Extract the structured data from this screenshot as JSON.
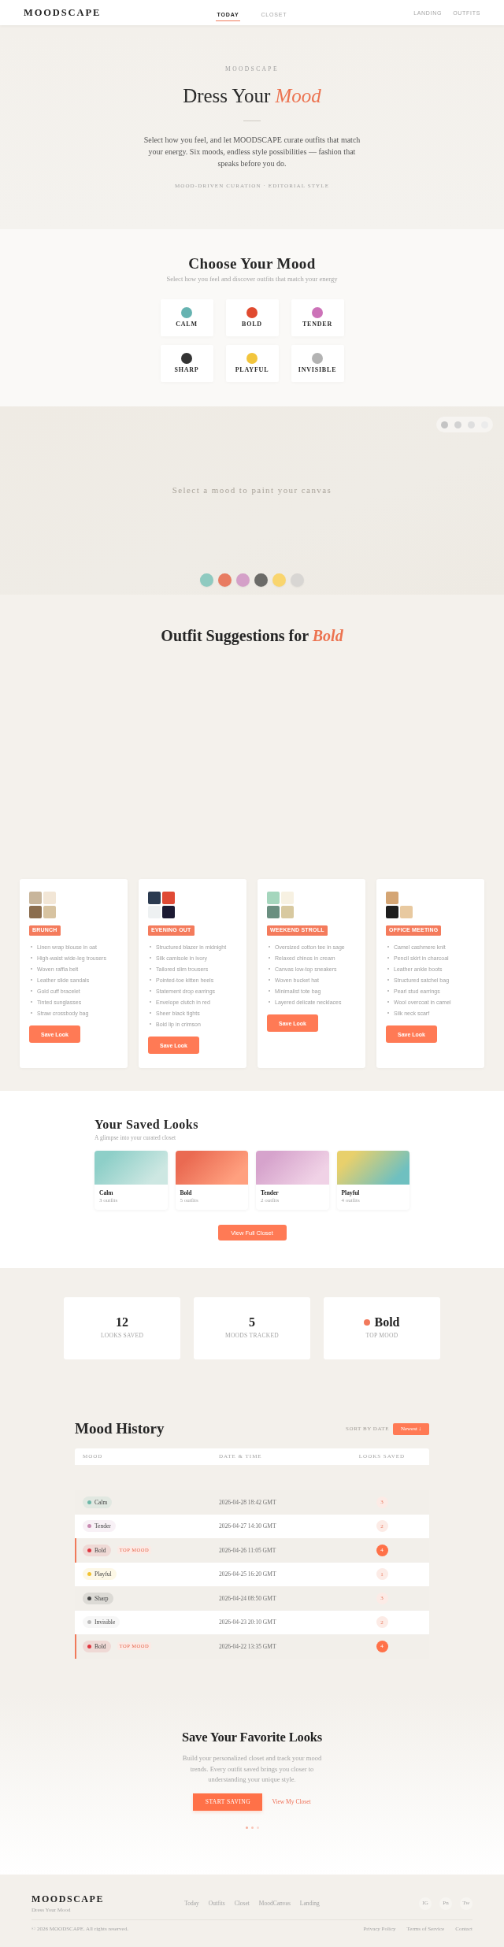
{
  "nav": {
    "logo": "MOODSCAPE",
    "tabs": [
      {
        "label": "TODAY",
        "selected": true
      },
      {
        "label": "CLOSET",
        "selected": false
      }
    ],
    "links": [
      {
        "label": "LANDING"
      },
      {
        "label": "OUTFITS"
      }
    ]
  },
  "hero": {
    "eyebrow": "MOODSCAPE",
    "title": "Dress Your *Mood*",
    "text": "Select how you feel, and let MOODSCAPE curate outfits that match your energy. Six moods, endless style possibilities — fashion that speaks before you do.",
    "tagline": "MOOD-DRIVEN CURATION · EDITORIAL STYLE"
  },
  "moods": {
    "title": "Choose Your Mood",
    "subtitle": "Select how you feel and discover outfits that match your energy",
    "items": [
      {
        "label": "CALM",
        "color": "#66b3b1"
      },
      {
        "label": "BOLD",
        "color": "#e04a2f"
      },
      {
        "label": "TENDER",
        "color": "#cc72b8"
      },
      {
        "label": "SHARP",
        "color": "#333333"
      },
      {
        "label": "PLAYFUL",
        "color": "#f2c53d"
      },
      {
        "label": "INVISIBLE",
        "color": "#b3b3b3"
      }
    ]
  },
  "canvas": {
    "message": "Select a mood to paint your canvas",
    "tools": [
      {
        "color": "#c4c4c4"
      },
      {
        "color": "#d2d2d2"
      },
      {
        "color": "#dedede"
      },
      {
        "color": "#ebebeb"
      }
    ],
    "palette": [
      {
        "color": "#8fcac0"
      },
      {
        "color": "#e87c62"
      },
      {
        "color": "#d4a0c8"
      },
      {
        "color": "#6b6b68"
      },
      {
        "color": "#f9d56e"
      },
      {
        "color": "#d8d6d3"
      }
    ]
  },
  "outfits": {
    "title": "Outfit Suggestions for *Bold*",
    "cards": [
      {
        "occasion": "BRUNCH",
        "swatch_rows": [
          [
            {
              "color": "#c8b59b"
            },
            {
              "color": "#f2e6d6"
            }
          ],
          [
            {
              "color": "#8b6d4e"
            },
            {
              "color": "#d7c3a1"
            }
          ]
        ],
        "items": [
          "Linen wrap blouse in oat",
          "High-waist wide-leg trousers",
          "Woven raffia belt",
          "Leather slide sandals",
          "Gold cuff bracelet",
          "Tinted sunglasses",
          "Straw crossbody bag"
        ],
        "button": "Save Look"
      },
      {
        "occasion": "EVENING OUT",
        "swatch_rows": [
          [
            {
              "color": "#2b3a50"
            },
            {
              "color": "#e04a35"
            }
          ],
          [
            {
              "color": "#eef1f2"
            },
            {
              "color": "#1c1a33"
            }
          ]
        ],
        "items": [
          "Structured blazer in midnight",
          "Silk camisole in ivory",
          "Tailored slim trousers",
          "Pointed-toe kitten heels",
          "Statement drop earrings",
          "Envelope clutch in red",
          "Sheer black tights",
          "Bold lip in crimson"
        ],
        "button": "Save Look"
      },
      {
        "occasion": "WEEKEND STROLL",
        "swatch_rows": [
          [
            {
              "color": "#a5d6bd"
            },
            {
              "color": "#f7f1e2"
            }
          ],
          [
            {
              "color": "#6a8f80"
            },
            {
              "color": "#d8c9a0"
            }
          ]
        ],
        "items": [
          "Oversized cotton tee in sage",
          "Relaxed chinos in cream",
          "Canvas low-top sneakers",
          "Woven bucket hat",
          "Minimalist tote bag",
          "Layered delicate necklaces"
        ],
        "button": "Save Look"
      },
      {
        "occasion": "OFFICE MEETING",
        "swatch_rows": [
          [
            {
              "color": "#d4a574"
            }
          ],
          [
            {
              "color": "#1e1e1e"
            },
            {
              "color": "#e8c9a0"
            }
          ]
        ],
        "items": [
          "Camel cashmere knit",
          "Pencil skirt in charcoal",
          "Leather ankle boots",
          "Structured satchel bag",
          "Pearl stud earrings",
          "Wool overcoat in camel",
          "Silk neck scarf"
        ],
        "button": "Save Look"
      }
    ]
  },
  "saved_looks": {
    "title": "Your Saved Looks",
    "subtitle": "A glimpse into your curated closet",
    "items": [
      {
        "name": "Calm",
        "count": "3 outfits",
        "gradient": [
          {
            "color": "#8ecfc8"
          },
          {
            "color": "#cde7e2"
          }
        ]
      },
      {
        "name": "Bold",
        "count": "5 outfits",
        "gradient": [
          {
            "color": "#ea6a52"
          },
          {
            "color": "#ffa07f"
          }
        ]
      },
      {
        "name": "Tender",
        "count": "2 outfits",
        "gradient": [
          {
            "color": "#d6a3cc"
          },
          {
            "color": "#f0d2e6"
          }
        ]
      },
      {
        "name": "Playful",
        "count": "4 outfits",
        "gradient": [
          {
            "color": "#e8d06c"
          },
          {
            "color": "#6fc0c0"
          }
        ]
      }
    ],
    "button": "View Full Closet"
  },
  "stats": [
    {
      "value": "12",
      "label": "LOOKS SAVED"
    },
    {
      "value": "5",
      "label": "MOODS TRACKED"
    },
    {
      "value": "Bold",
      "label": "TOP MOOD",
      "color": "#f27a5c"
    }
  ],
  "history": {
    "title": "Mood History",
    "sort_label": "SORT BY DATE",
    "sort_button": "Newest ↓",
    "columns": [
      "MOOD",
      "DATE & TIME",
      "LOOKS SAVED"
    ],
    "rows": [
      {
        "mood": "Calm",
        "color": "#6cb7a8",
        "date": "2026-04-28 18:42 GMT",
        "looks": "3",
        "highlighted": false
      },
      {
        "mood": "Tender",
        "color": "#c98bb2",
        "date": "2026-04-27 14:30 GMT",
        "looks": "2",
        "highlighted": false
      },
      {
        "mood": "Bold",
        "color": "#e0363f",
        "tag": "TOP MOOD",
        "date": "2026-04-26 11:05 GMT",
        "looks": "4",
        "highlighted": true
      },
      {
        "mood": "Playful",
        "color": "#f2c230",
        "date": "2026-04-25 16:20 GMT",
        "looks": "1",
        "highlighted": false
      },
      {
        "mood": "Sharp",
        "color": "#444444",
        "date": "2026-04-24 08:50 GMT",
        "looks": "3",
        "highlighted": false
      },
      {
        "mood": "Invisible",
        "color": "#bbbbbb",
        "date": "2026-04-23 20:10 GMT",
        "looks": "2",
        "highlighted": false
      },
      {
        "mood": "Bold",
        "color": "#e0363f",
        "tag": "TOP MOOD",
        "date": "2026-04-22 13:35 GMT",
        "looks": "4",
        "highlighted": true
      }
    ]
  },
  "cta": {
    "title": "Save Your Favorite Looks",
    "text": "Build your personalized closet and track your mood trends. Every outfit saved brings you closer to understanding your unique style.",
    "button": "START SAVING",
    "link": "View My Closet"
  },
  "footer": {
    "logo": "MOODSCAPE",
    "tagline": "Dress Your Mood",
    "links": [
      "Today",
      "Outfits",
      "Closet",
      "MoodCanvas",
      "Landing"
    ],
    "social": [
      "IG",
      "Pn",
      "Tw"
    ],
    "copyright": "© 2026 MOODSCAPE. All rights reserved.",
    "legal": [
      "Privacy Policy",
      "Terms of Service",
      "Contact"
    ]
  }
}
